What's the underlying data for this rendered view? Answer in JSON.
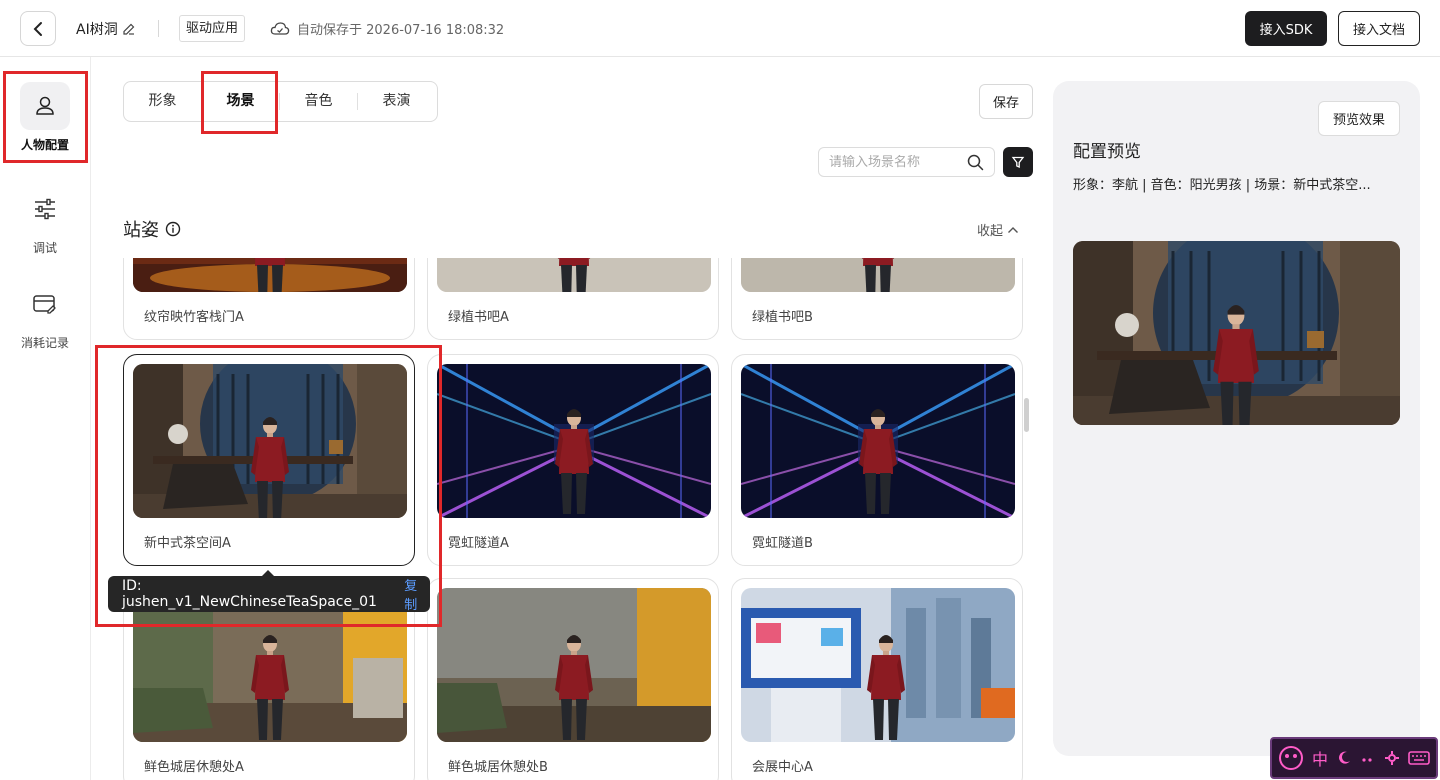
{
  "header": {
    "app_name": "AI树洞",
    "mode_tag": "驱动应用",
    "autosave": "自动保存于 2026-07-16 18:08:32",
    "sdk_button": "接入SDK",
    "doc_button": "接入文档"
  },
  "sidebar": {
    "items": [
      {
        "label": "人物配置",
        "icon": "person-icon",
        "active": true
      },
      {
        "label": "调试",
        "icon": "sliders-icon",
        "active": false
      },
      {
        "label": "消耗记录",
        "icon": "card-icon",
        "active": false
      }
    ]
  },
  "tabs": [
    {
      "label": "形象",
      "active": false
    },
    {
      "label": "场景",
      "active": true
    },
    {
      "label": "音色",
      "active": false
    },
    {
      "label": "表演",
      "active": false
    }
  ],
  "save_button": "保存",
  "search": {
    "placeholder": "请输入场景名称",
    "value": ""
  },
  "section": {
    "title": "站姿",
    "collapse_label": "收起"
  },
  "scenes": [
    {
      "name": "纹帘映竹客栈门A"
    },
    {
      "name": "绿植书吧A"
    },
    {
      "name": "绿植书吧B"
    },
    {
      "name": "新中式茶空间A",
      "selected": true
    },
    {
      "name": "霓虹隧道A"
    },
    {
      "name": "霓虹隧道B"
    },
    {
      "name": "鲜色城居休憩处A"
    },
    {
      "name": "鲜色城居休憩处B"
    },
    {
      "name": "会展中心A"
    }
  ],
  "tooltip": {
    "id_text": "ID: jushen_v1_NewChineseTeaSpace_01",
    "copy_label": "复制"
  },
  "preview": {
    "button": "预览效果",
    "title": "配置预览",
    "info": "形象：李航 | 音色：阳光男孩 | 场景：新中式茶空..."
  },
  "ime": {
    "label": "中"
  },
  "colors": {
    "accent": "#1d1d1f",
    "highlight": "#e0282a",
    "link": "#5b9cff"
  }
}
